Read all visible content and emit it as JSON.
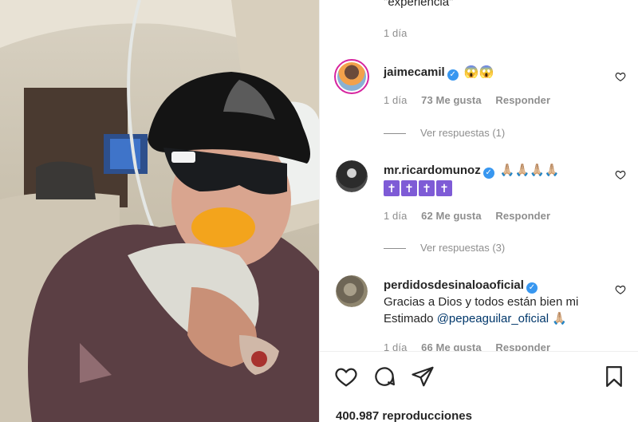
{
  "post": {
    "caption_tail": "\"experiencia\"",
    "caption_age": "1 día"
  },
  "comments": [
    {
      "username": "jaimecamil",
      "text": "😱😱",
      "age": "1 día",
      "likes": "73 Me gusta",
      "reply_label": "Responder",
      "view_replies": "Ver respuestas (1)"
    },
    {
      "username": "mr.ricardomunoz",
      "text": "🙏🏼🙏🏼🙏🏼🙏🏼",
      "crosses": [
        "✝",
        "✝",
        "✝",
        "✝"
      ],
      "age": "1 día",
      "likes": "62 Me gusta",
      "reply_label": "Responder",
      "view_replies": "Ver respuestas (3)"
    },
    {
      "username": "perdidosdesinaloaoficial",
      "text_before": "Gracias a Dios y todos están bien mi Estimado",
      "mention": "@pepeaguilar_oficial",
      "text_after": "🙏🏼",
      "age": "1 día",
      "likes": "66 Me gusta",
      "reply_label": "Responder"
    }
  ],
  "footer": {
    "views": "400.987 reproducciones"
  },
  "icons": {
    "like": "heart-icon",
    "comment": "comment-icon",
    "share": "share-icon",
    "save": "bookmark-icon",
    "verified": "verified-badge-icon"
  },
  "colors": {
    "text": "#262626",
    "muted": "#8e8e8e",
    "verified": "#3897f0",
    "mention": "#00376b"
  }
}
